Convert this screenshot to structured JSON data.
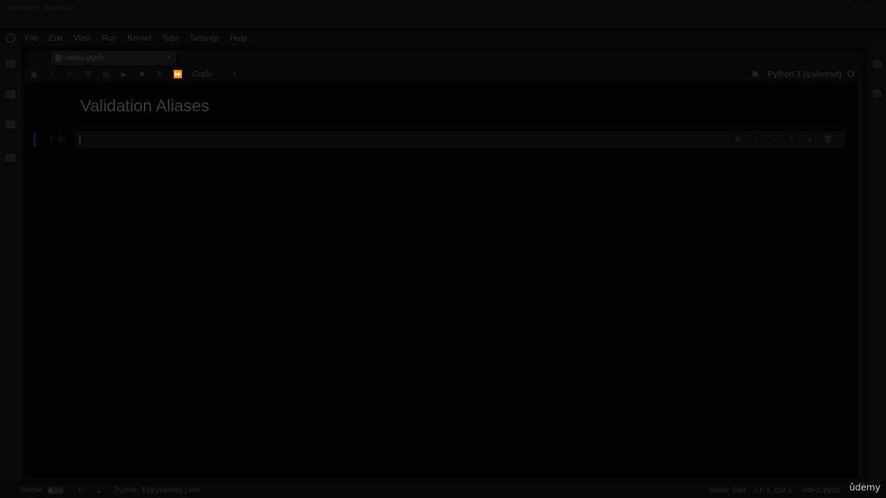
{
  "window": {
    "title": "video.ipynb - JupyterLab"
  },
  "menubar": {
    "items": [
      "File",
      "Edit",
      "View",
      "Run",
      "Kernel",
      "Tabs",
      "Settings",
      "Help"
    ]
  },
  "tabs": [
    {
      "label": "video.ipynb",
      "close_icon": "×"
    }
  ],
  "notebook_toolbar": {
    "icons": [
      "save-icon",
      "add-cell-icon",
      "cut-icon",
      "copy-icon",
      "paste-icon",
      "run-icon",
      "stop-icon",
      "restart-icon",
      "fast-forward-icon"
    ],
    "cell_type": "Code",
    "kernel_name": "Python 3 (ipykernel)"
  },
  "notebook": {
    "heading": "Validation Aliases",
    "cell": {
      "prompt": "[ ]:",
      "source": ""
    }
  },
  "statusbar": {
    "simple_label": "Simple",
    "count_a": "0",
    "count_b": "1",
    "kernel_status": "Python 3 (ipykernel) | Idle",
    "mode": "Mode: Edit",
    "position": "Ln 1, Col 1",
    "file": "video.ipynb"
  },
  "watermark": "ûdemy"
}
